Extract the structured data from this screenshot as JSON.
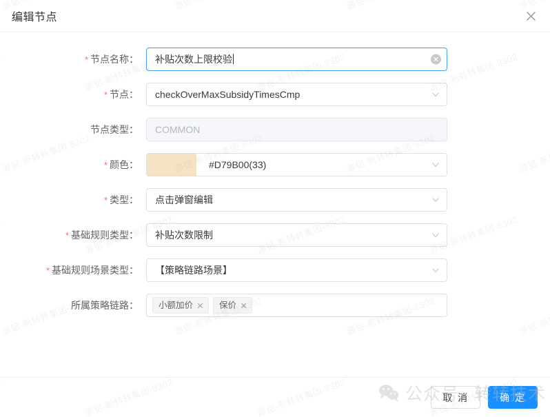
{
  "dialog": {
    "title": "编辑节点",
    "close_icon": "close-icon"
  },
  "form": {
    "rows": [
      {
        "label": "节点名称：",
        "required": true,
        "type": "input",
        "value": "补贴次数上限校验",
        "focused": true,
        "clearable": true
      },
      {
        "label": "节点：",
        "required": true,
        "type": "select",
        "value": "checkOverMaxSubsidyTimesCmp"
      },
      {
        "label": "节点类型：",
        "required": false,
        "type": "input",
        "value": "COMMON",
        "disabled": true
      },
      {
        "label": "颜色：",
        "required": true,
        "type": "color",
        "value": "#D79B00(33)",
        "swatch_color": "#f4e4c5"
      },
      {
        "label": "类型：",
        "required": true,
        "type": "select",
        "value": "点击弹窗编辑"
      },
      {
        "label": "基础规则类型：",
        "required": true,
        "type": "select",
        "value": "补贴次数限制"
      },
      {
        "label": "基础规则场景类型：",
        "required": true,
        "type": "select",
        "value": "【策略链路场景】"
      },
      {
        "label": "所属策略链路：",
        "required": false,
        "type": "tags",
        "tags": [
          "小额加价",
          "保价"
        ]
      }
    ]
  },
  "footer": {
    "cancel_label": "取 消",
    "confirm_label": "确 定"
  },
  "promo": {
    "prefix": "公众号",
    "brand": "转转技术"
  },
  "watermark": {
    "text": "源铝-新转转集团-8302"
  },
  "colors": {
    "primary": "#1890ff",
    "required_star": "#f56c6c",
    "focus_border": "#409eff",
    "node_color_hex": "#D79B00"
  }
}
